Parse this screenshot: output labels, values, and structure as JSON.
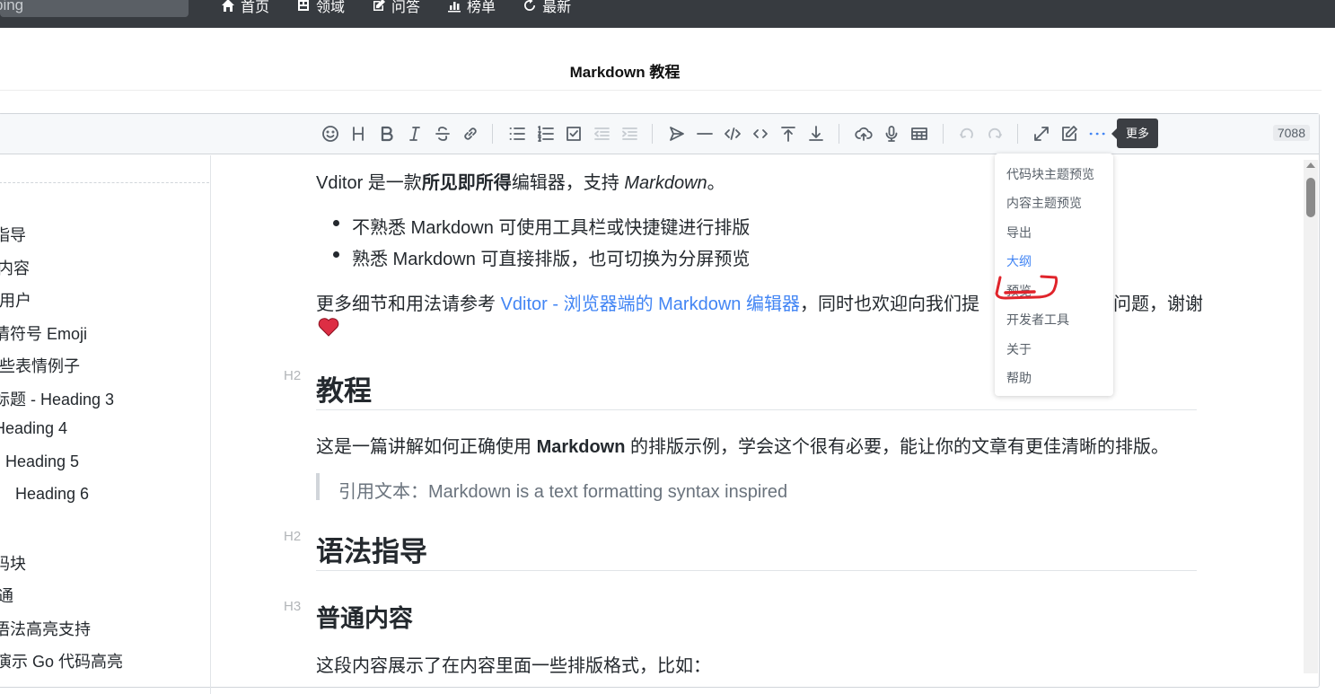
{
  "topbar": {
    "search_text": "bing",
    "nav": [
      {
        "label": "首页",
        "icon": "home-icon"
      },
      {
        "label": "领域",
        "icon": "domain-icon"
      },
      {
        "label": "问答",
        "icon": "qa-edit-icon"
      },
      {
        "label": "榜单",
        "icon": "chart-icon"
      },
      {
        "label": "最新",
        "icon": "refresh-icon"
      }
    ]
  },
  "page": {
    "title": "Markdown 教程"
  },
  "toolbar": {
    "tooltip": "更多",
    "counter": "7088",
    "icons": [
      "emoji-icon",
      "heading-icon",
      "bold-icon",
      "italic-icon",
      "strike-icon",
      "link-icon",
      "list-icon",
      "ordered-list-icon",
      "check-icon",
      "outdent-icon",
      "indent-icon",
      "quote-icon",
      "line-icon",
      "code-icon",
      "inline-code-icon",
      "insert-before-icon",
      "insert-after-icon",
      "upload-icon",
      "record-icon",
      "table-icon",
      "undo-icon",
      "redo-icon",
      "fullscreen-icon",
      "edit-mode-icon",
      "more-icon"
    ]
  },
  "dropdown": {
    "items": [
      {
        "label": "代码块主题预览",
        "active": false
      },
      {
        "label": "内容主题预览",
        "active": false
      },
      {
        "label": "导出",
        "active": false
      },
      {
        "label": "大纲",
        "active": true
      },
      {
        "label": "预览",
        "active": false
      },
      {
        "label": "开发者工具",
        "active": false
      },
      {
        "label": "关于",
        "active": false
      },
      {
        "label": "帮助",
        "active": false
      }
    ]
  },
  "outline": {
    "items": [
      "指导",
      "内容",
      "用户",
      "情符号 Emoji",
      "些表情例子",
      "标题 - Heading 3",
      "Heading 4",
      "Heading 5",
      "Heading 6",
      "码块",
      "通",
      "语法高亮支持",
      "演示 Go 代码高亮"
    ]
  },
  "content": {
    "intro_a": "Vditor 是一款",
    "intro_bold": "所见即所得",
    "intro_b": "编辑器，支持 ",
    "intro_italic": "Markdown",
    "intro_c": "。",
    "bullet1": "不熟悉 Markdown 可使用工具栏或快捷键进行排版",
    "bullet2": "熟悉 Markdown 可直接排版，也可切换为分屏预览",
    "more_a": "更多细节和用法请参考 ",
    "more_link": "Vditor - 浏览器端的 Markdown 编辑器",
    "more_b": "，同时也欢迎向我们提",
    "more_c": "问题，谢谢",
    "h2_marker": "H2",
    "h3_marker": "H3",
    "tutorial_heading": "教程",
    "tutorial_a": "这是一篇讲解如何正确使用 ",
    "tutorial_bold": "Markdown",
    "tutorial_b": " 的排版示例，学会这个很有必要，能让你的文章有更佳清晰的排版。",
    "quote": "引用文本：Markdown is a text formatting syntax inspired",
    "syntax_heading": "语法指导",
    "normal_heading": "普通内容",
    "normal_text": "这段内容展示了在内容里面一些排版格式，比如："
  },
  "colors": {
    "accent": "#4285f4",
    "topbar": "#373b40",
    "annotation": "#e0242b"
  }
}
